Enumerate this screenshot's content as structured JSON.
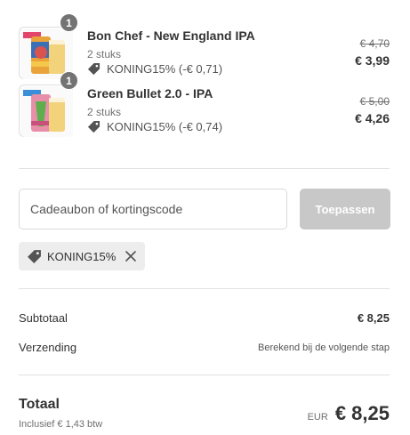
{
  "items": [
    {
      "name": "Bon Chef - New England IPA",
      "quantity_badge": "1",
      "quantity_text": "2 stuks",
      "discount": "KONING15% (-€ 0,71)",
      "price_original": "€ 4,70",
      "price_final": "€ 3,99",
      "thumbnail": "beer-can-image"
    },
    {
      "name": "Green Bullet 2.0 - IPA",
      "quantity_badge": "1",
      "quantity_text": "2 stuks",
      "discount": "KONING15% (-€ 0,74)",
      "price_original": "€ 5,00",
      "price_final": "€ 4,26",
      "thumbnail": "beer-can-image"
    }
  ],
  "discount_form": {
    "placeholder": "Cadeaubon of kortingscode",
    "value": "",
    "apply_label": "Toepassen"
  },
  "applied_code": {
    "label": "KONING15%",
    "icon": "tag-icon",
    "remove_icon": "close-icon"
  },
  "summary": {
    "subtotal_label": "Subtotaal",
    "subtotal_value": "€ 8,25",
    "shipping_label": "Verzending",
    "shipping_value": "Berekend bij de volgende stap",
    "total_label": "Totaal",
    "tax_note": "Inclusief € 1,43 btw",
    "currency": "EUR",
    "total_value": "€ 8,25"
  },
  "colors": {
    "button_disabled": "#c8c8c8",
    "badge": "#737373",
    "chip_bg": "#ededed",
    "text": "#333333",
    "muted": "#707070"
  }
}
